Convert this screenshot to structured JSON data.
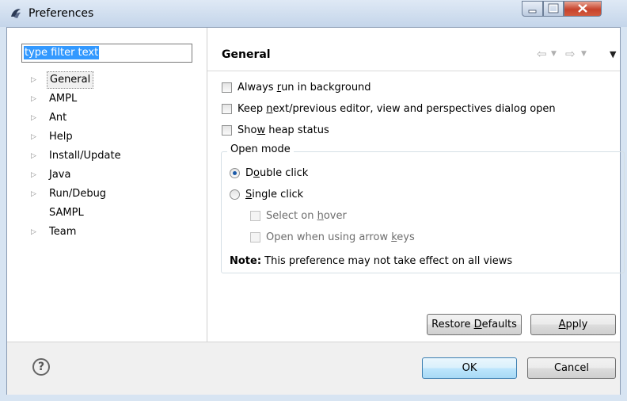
{
  "window": {
    "title": "Preferences"
  },
  "filter": {
    "value": "type filter text"
  },
  "tree": {
    "items": [
      {
        "label": "General",
        "expandable": true,
        "selected": true
      },
      {
        "label": "AMPL",
        "expandable": true
      },
      {
        "label": "Ant",
        "expandable": true
      },
      {
        "label": "Help",
        "expandable": true
      },
      {
        "label": "Install/Update",
        "expandable": true
      },
      {
        "label": "Java",
        "expandable": true
      },
      {
        "label": "Run/Debug",
        "expandable": true
      },
      {
        "label": "SAMPL",
        "expandable": false
      },
      {
        "label": "Team",
        "expandable": true
      }
    ]
  },
  "page": {
    "title": "General",
    "always_run_pre": "Always ",
    "always_run_u": "r",
    "always_run_post": "un in background",
    "keep_next_pre": "Keep ",
    "keep_next_u": "n",
    "keep_next_post": "ext/previous editor, view and perspectives dialog open",
    "show_heap_pre": "Sho",
    "show_heap_u": "w",
    "show_heap_post": " heap status",
    "open_mode_title": "Open mode",
    "double_click_pre": "D",
    "double_click_u": "o",
    "double_click_post": "uble click",
    "single_click_pre": "",
    "single_click_u": "S",
    "single_click_post": "ingle click",
    "select_hover_pre": "Select on ",
    "select_hover_u": "h",
    "select_hover_post": "over",
    "arrow_keys_pre": "Open when using arrow ",
    "arrow_keys_u": "k",
    "arrow_keys_post": "eys",
    "note_bold": "Note:",
    "note_text": " This preference may not take effect on all views",
    "restore_pre": "Restore ",
    "restore_u": "D",
    "restore_post": "efaults",
    "apply_u": "A",
    "apply_post": "pply"
  },
  "buttons": {
    "ok": "OK",
    "cancel": "Cancel",
    "help_glyph": "?"
  },
  "icons": {
    "back": "⇦",
    "forward": "⇨",
    "dropdown": "▼",
    "menu": "▼",
    "tree_arrow": "▷"
  },
  "colors": {
    "selection": "#3399ff",
    "radio_dot": "#1b5aa8"
  }
}
